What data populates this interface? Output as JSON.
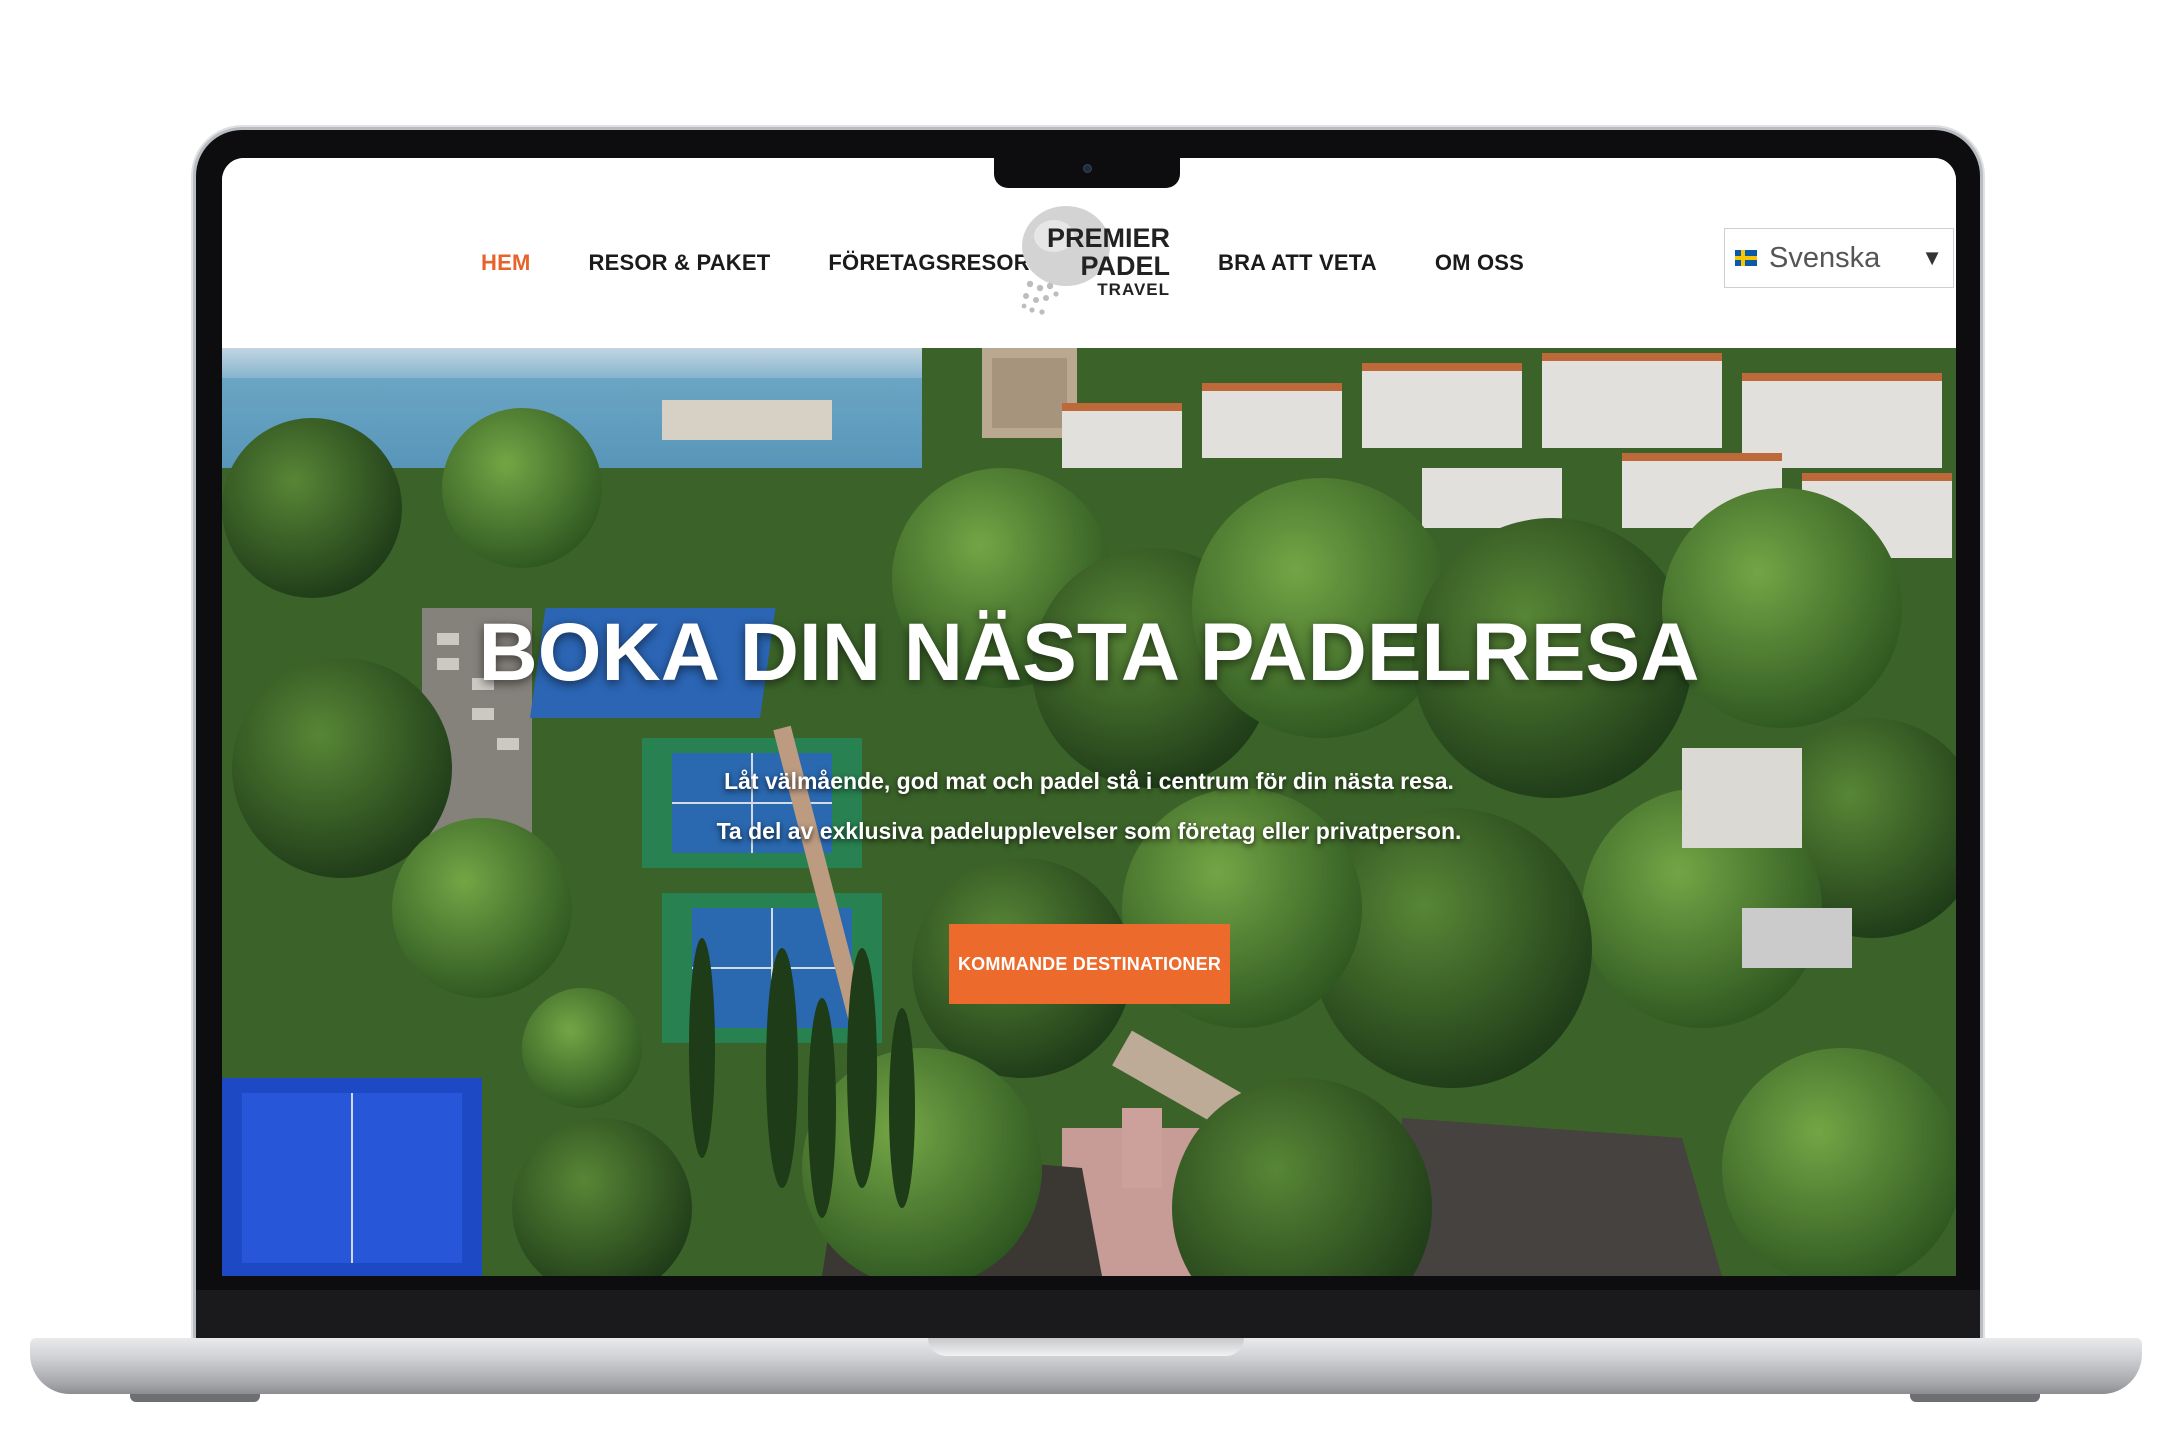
{
  "header": {
    "nav_left": [
      {
        "label": "HEM",
        "active": true
      },
      {
        "label": "RESOR & PAKET",
        "active": false
      },
      {
        "label": "FÖRETAGSRESOR",
        "active": false
      }
    ],
    "nav_right": [
      {
        "label": "BRA ATT VETA",
        "active": false
      },
      {
        "label": "OM OSS",
        "active": false
      }
    ],
    "logo": {
      "line1": "PREMIER",
      "line2": "PADEL",
      "line3": "TRAVEL"
    },
    "language": {
      "selected": "Svenska",
      "flag_icon": "sweden-flag-icon"
    }
  },
  "hero": {
    "title": "BOKA DIN NÄSTA PADELRESA",
    "text_line1": "Låt välmående, god mat och padel stå i centrum för din nästa resa.",
    "text_line2": "Ta del av exklusiva padelupplevelser som företag eller privatperson.",
    "cta_label": "KOMMANDE DESTINATIONER"
  },
  "colors": {
    "accent": "#ec6a2c",
    "active_nav": "#e8632b",
    "nav_text": "#1b1b1b"
  }
}
